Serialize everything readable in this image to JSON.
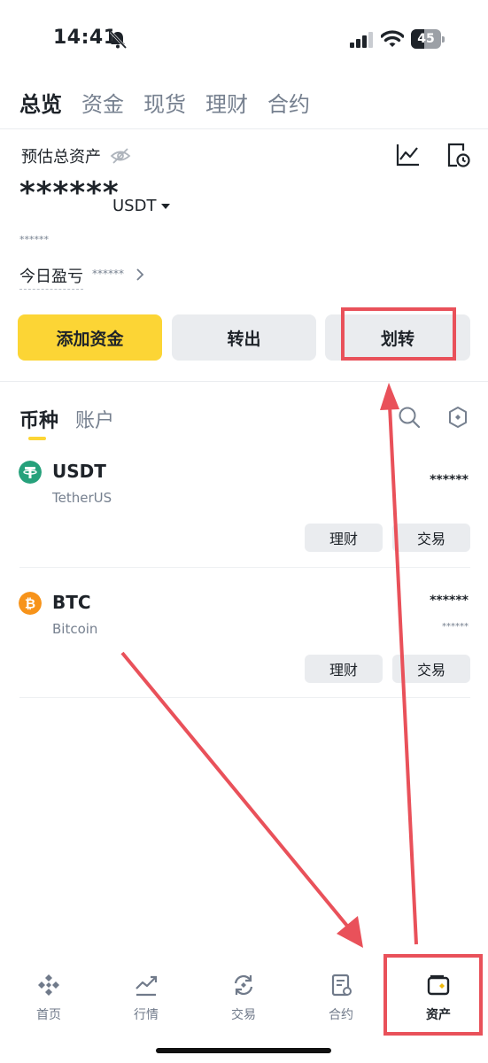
{
  "status_bar": {
    "time": "14:41",
    "battery": "45",
    "battery_level": 0.45
  },
  "top_tabs": [
    {
      "label": "总览",
      "active": true
    },
    {
      "label": "资金",
      "active": false
    },
    {
      "label": "现货",
      "active": false
    },
    {
      "label": "理财",
      "active": false
    },
    {
      "label": "合约",
      "active": false
    }
  ],
  "summary": {
    "label": "预估总资产",
    "total_value": "******",
    "currency": "USDT",
    "sub_value": "******",
    "pnl_label": "今日盈亏",
    "pnl_value": "******"
  },
  "actions": {
    "add_funds": "添加资金",
    "withdraw": "转出",
    "transfer": "划转"
  },
  "asset_tabs": {
    "coins": "币种",
    "accounts": "账户"
  },
  "coins": [
    {
      "symbol": "USDT",
      "name": "TetherUS",
      "amount": "******",
      "sub": "",
      "earn_label": "理财",
      "trade_label": "交易",
      "color": "#26a17b"
    },
    {
      "symbol": "BTC",
      "name": "Bitcoin",
      "amount": "******",
      "sub": "******",
      "earn_label": "理财",
      "trade_label": "交易",
      "color": "#f7931a"
    }
  ],
  "bottom_nav": [
    {
      "label": "首页",
      "icon": "binance-logo-icon",
      "active": false
    },
    {
      "label": "行情",
      "icon": "market-chart-icon",
      "active": false
    },
    {
      "label": "交易",
      "icon": "trade-swap-icon",
      "active": false
    },
    {
      "label": "合约",
      "icon": "futures-doc-icon",
      "active": false
    },
    {
      "label": "资产",
      "icon": "wallet-icon",
      "active": true
    }
  ],
  "colors": {
    "brand_yellow": "#fcd535",
    "annotation_red": "#e9515a",
    "text_primary": "#1e2329",
    "text_secondary": "#76808f"
  }
}
